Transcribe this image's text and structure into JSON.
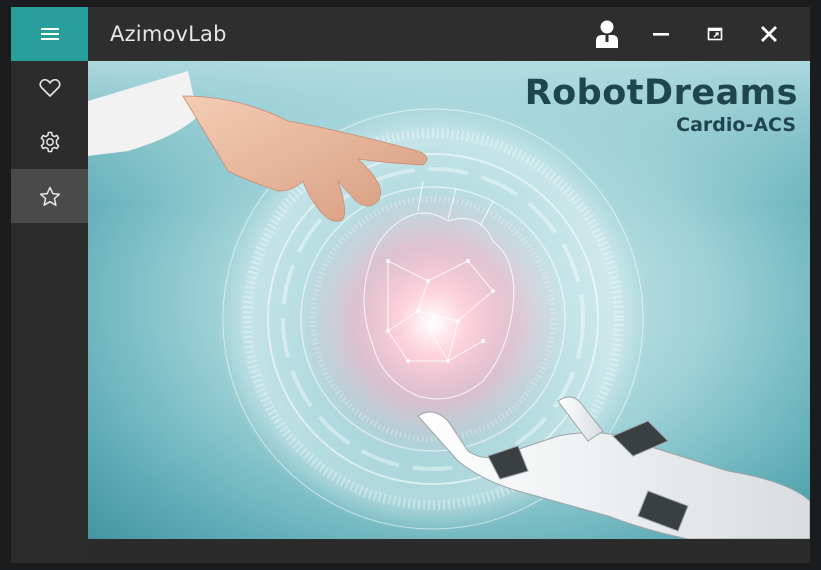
{
  "window": {
    "title": "AzimovLab"
  },
  "titlebar": {
    "menu_icon": "hamburger-menu-icon",
    "user_icon": "user-icon",
    "minimize_icon": "minimize-icon",
    "restore_icon": "restore-window-icon",
    "close_icon": "close-icon"
  },
  "sidebar": {
    "items": [
      {
        "icon": "heart-icon",
        "active": false
      },
      {
        "icon": "gear-icon",
        "active": false
      },
      {
        "icon": "star-icon",
        "active": true
      }
    ]
  },
  "splash": {
    "brand": "RobotDreams",
    "product": "Cardio-ACS"
  },
  "colors": {
    "accent": "#279e99",
    "titlebar": "#2e2e2e",
    "sidebar": "#2c2c2c",
    "sidebar_active": "#4a4a4a",
    "brand_text": "#1f4550"
  }
}
